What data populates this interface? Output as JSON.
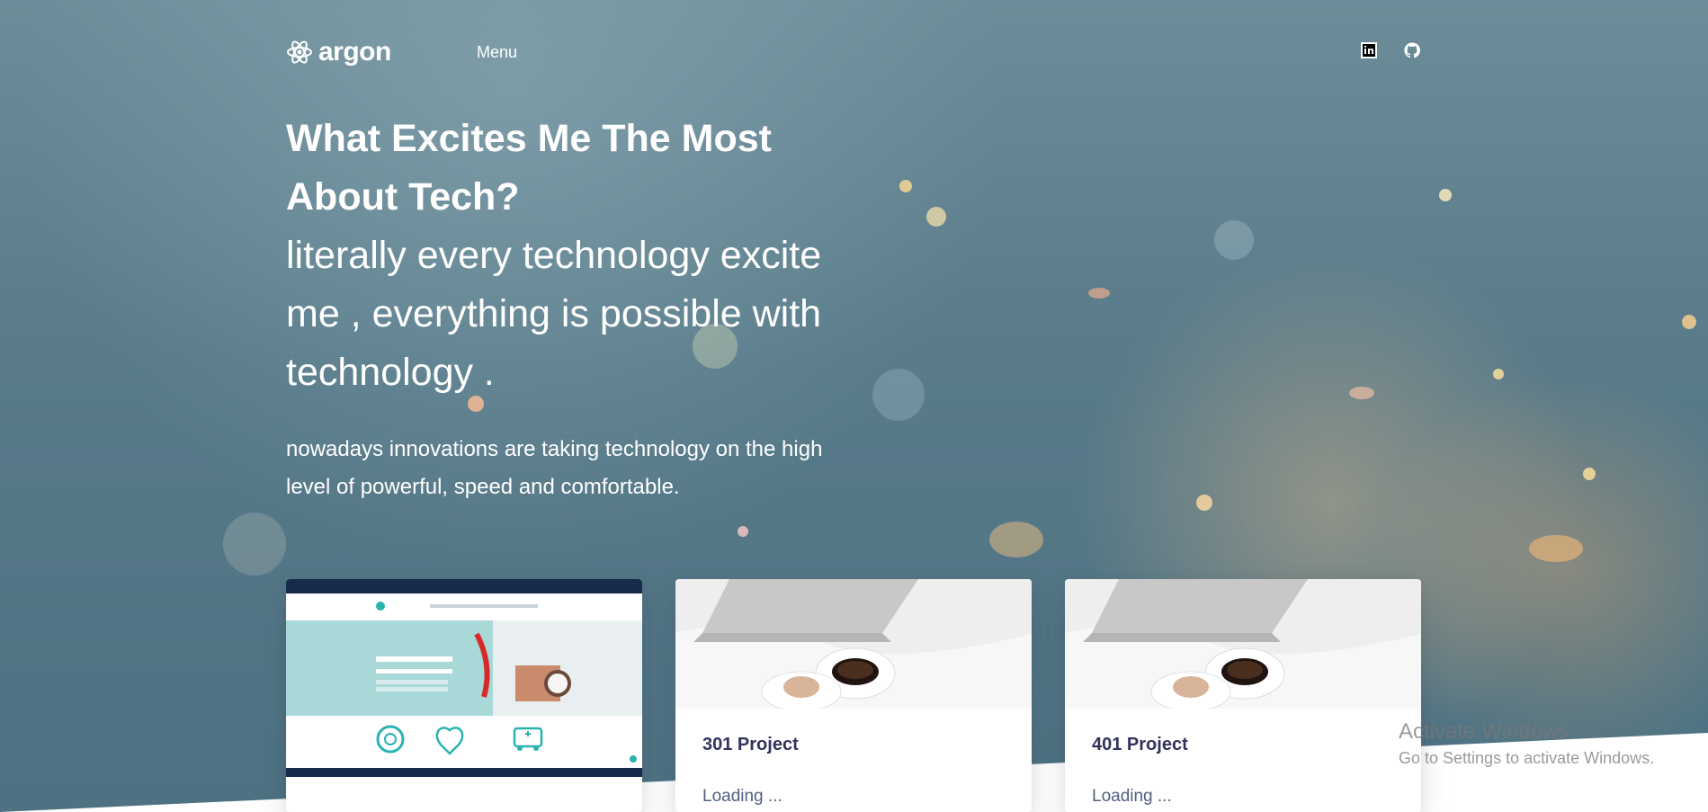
{
  "nav": {
    "brand": "argon",
    "menu_label": "Menu",
    "social_icons": [
      "linkedin-icon",
      "github-icon"
    ]
  },
  "hero": {
    "title": "What Excites Me The Most About Tech?",
    "subtitle": "literally every technology excite me , everything is possible with technology .",
    "lead": "nowadays innovations are taking technology on the high level of powerful, speed and comfortable."
  },
  "cards": [
    {
      "title": "",
      "text": ""
    },
    {
      "title": "301 Project",
      "text": "Loading ..."
    },
    {
      "title": "401 Project",
      "text": "Loading ..."
    }
  ],
  "watermark": {
    "title": "Activate Windows",
    "subtitle": "Go to Settings to activate Windows."
  },
  "colors": {
    "hero_bg": "#587a89",
    "card_title": "#32325d",
    "card_text": "#525f7f",
    "screenshot_frame": "#172b4d",
    "accent_teal": "#2bb3b0"
  }
}
